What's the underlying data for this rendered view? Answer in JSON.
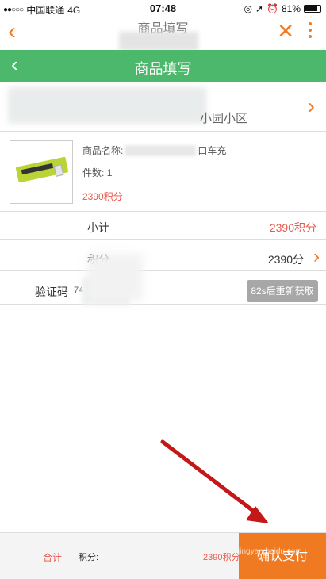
{
  "status_bar": {
    "carrier": "中国联通",
    "network": "4G",
    "time": "07:48",
    "battery": "81%"
  },
  "browser": {
    "title": "商品填写",
    "back_icon": "chevron-left-icon",
    "close_icon": "close-icon",
    "more_icon": "kebab-menu-icon"
  },
  "header": {
    "title": "商品填写",
    "back_icon": "chevron-left-icon"
  },
  "address": {
    "text": "小园小区"
  },
  "product": {
    "name_prefix": "商品名称:",
    "name_suffix": "口车充",
    "quantity_label": "件数:",
    "quantity": "1",
    "points": "2390积分"
  },
  "summary": {
    "subtotal_label": "小计",
    "subtotal_value": "2390积分",
    "points_label": "积分",
    "points_value": "2390分"
  },
  "verification": {
    "label": "验证码",
    "value": "74",
    "resend_button": "82s后重新获取"
  },
  "bottom_bar": {
    "total_label": "合计",
    "points_label": "积分:",
    "points_value": "2390积分",
    "confirm_button": "确认支付"
  },
  "watermark": "jingyan.baidu.com",
  "colors": {
    "accent": "#f07a21",
    "header_green": "#4cb86b",
    "price_red": "#e85a4f",
    "resend_gray": "#a7a7a7"
  }
}
